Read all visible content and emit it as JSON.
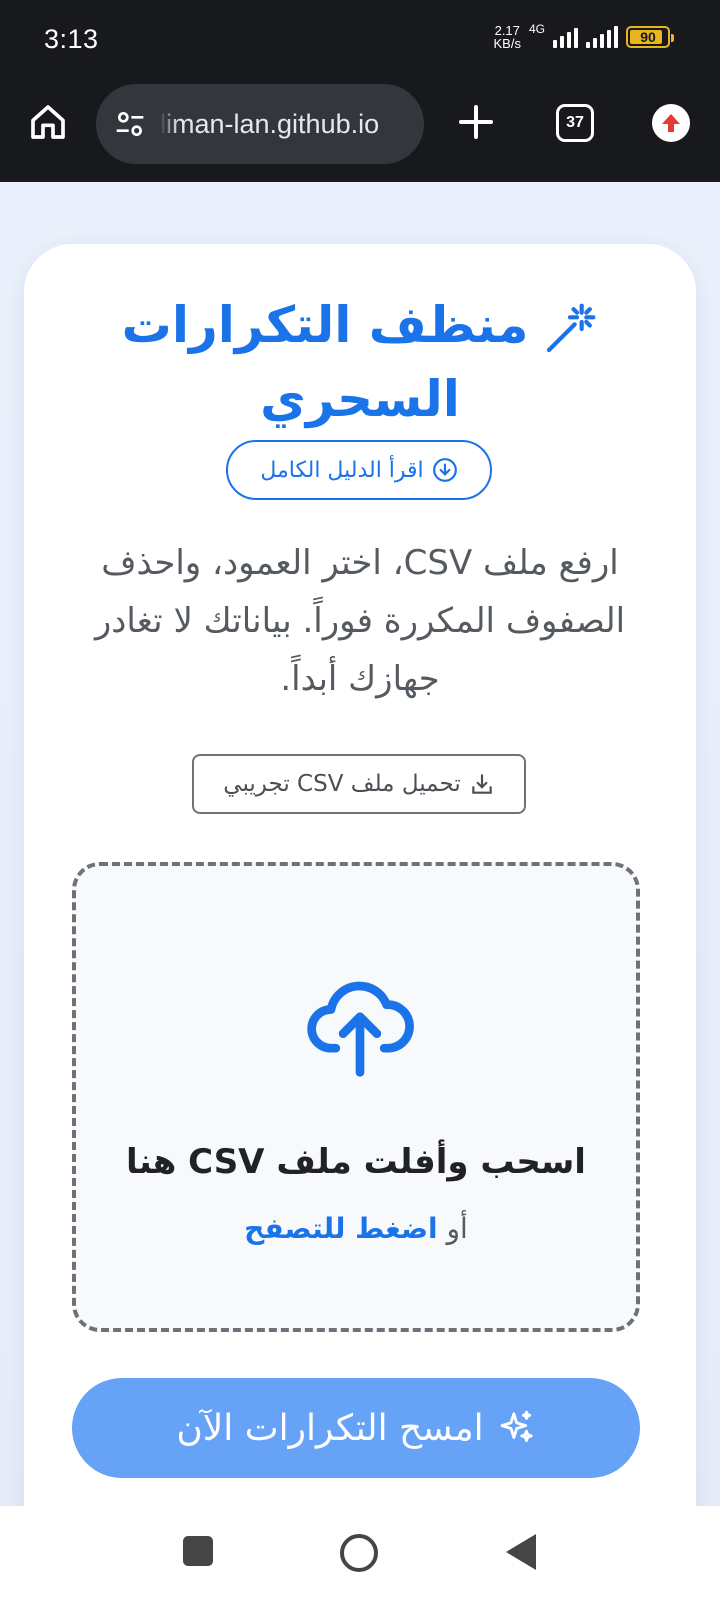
{
  "status": {
    "time": "3:13",
    "net_speed_value": "2.17",
    "net_speed_unit": "KB/s",
    "network": "4G",
    "battery": "90"
  },
  "browser": {
    "url": "liman-lan.github.io",
    "tab_count": "37",
    "icons": [
      "home-icon",
      "site-settings-icon",
      "new-tab-plus-icon",
      "tab-switcher-icon",
      "update-icon"
    ]
  },
  "app": {
    "title": "منظف التكرارات السحري",
    "guide_button": "اقرأ الدليل الكامل",
    "description": "ارفع ملف CSV، اختر العمود، واحذف الصفوف المكررة فوراً. بياناتك لا تغادر جهازك أبداً.",
    "sample_button": "تحميل ملف CSV تجريبي",
    "dropzone": {
      "title": "اسحب وأفلت ملف CSV هنا",
      "or": "أو",
      "browse_link": "اضغط للتصفح"
    },
    "clean_button": "امسح التكرارات الآن",
    "colors": {
      "accent": "#1a73e8",
      "button": "#66a2f5"
    }
  }
}
